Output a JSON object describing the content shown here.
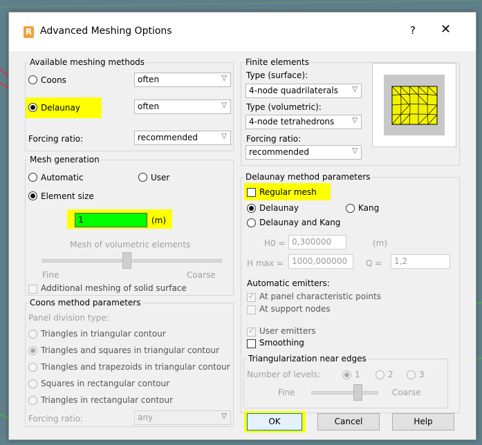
{
  "dialog": {
    "icon_letter": "R",
    "title": "Advanced Meshing Options",
    "help": "?",
    "close": "✕"
  },
  "available": {
    "title": "Available meshing methods",
    "coons_label": "Coons",
    "coons_value": "often",
    "delaunay_label": "Delaunay",
    "delaunay_value": "often",
    "forcing_label": "Forcing ratio:",
    "forcing_value": "recommended"
  },
  "finite": {
    "title": "Finite elements",
    "surface_label": "Type (surface):",
    "surface_value": "4-node quadrilaterals",
    "vol_label": "Type (volumetric):",
    "vol_value": "4-node tetrahedrons",
    "forcing_label": "Forcing ratio:",
    "forcing_value": "recommended"
  },
  "mesh_gen": {
    "title": "Mesh generation",
    "automatic": "Automatic",
    "user": "User",
    "element_size": "Element size",
    "size_value": "1",
    "size_unit": "(m)",
    "volumetric_label": "Mesh of volumetric elements",
    "fine": "Fine",
    "coarse": "Coarse",
    "additional": "Additional meshing of solid surface"
  },
  "coons": {
    "title": "Coons method parameters",
    "panel_type": "Panel division type:",
    "opt1": "Triangles in triangular contour",
    "opt2": "Triangles and squares in triangular contour",
    "opt3": "Triangles and trapezoids in triangular contour",
    "opt4": "Squares in rectangular contour",
    "opt5": "Triangles in rectangular contour",
    "forcing_label": "Forcing ratio:",
    "forcing_value": "any"
  },
  "delaunay": {
    "title": "Delaunay method parameters",
    "regular": "Regular mesh",
    "delaunay": "Delaunay",
    "kang": "Kang",
    "delaunay_kang": "Delaunay and Kang",
    "h0_label": "H0 =",
    "h0_value": "0,300000",
    "h0_unit": "(m)",
    "hmax_label": "H max =",
    "hmax_value": "1000,000000",
    "q_label": "Q =",
    "q_value": "1,2",
    "emitters_title": "Automatic emitters:",
    "panel_points": "At panel characteristic points",
    "support_nodes": "At support nodes",
    "user_emitters": "User emitters",
    "smoothing": "Smoothing",
    "tri_title": "Triangularization near edges",
    "levels_label": "Number of levels:",
    "level1": "1",
    "level2": "2",
    "level3": "3",
    "fine": "Fine",
    "coarse": "Coarse"
  },
  "buttons": {
    "ok": "OK",
    "cancel": "Cancel",
    "help": "Help"
  },
  "colors": {
    "highlight": "#ffff00",
    "input_highlight": "#00ff00",
    "preview_mesh": "#f2f200"
  }
}
